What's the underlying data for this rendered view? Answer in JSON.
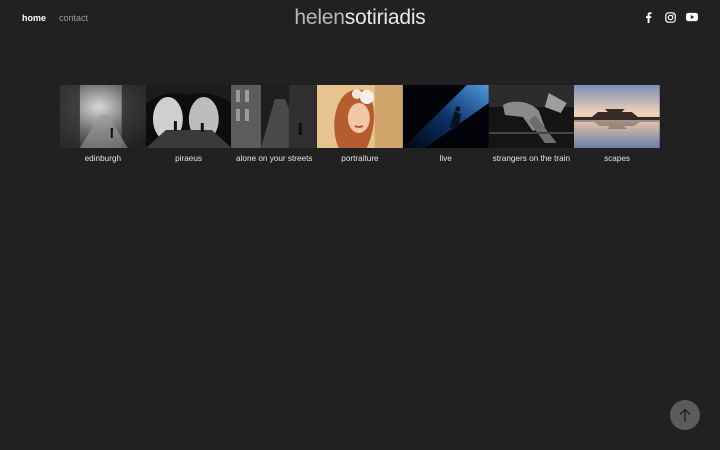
{
  "nav": {
    "home_label": "home",
    "contact_label": "contact"
  },
  "logo": {
    "part1": "helen",
    "part2": "sotiriadis"
  },
  "social": {
    "icons": [
      "facebook-icon",
      "instagram-icon",
      "youtube-icon"
    ]
  },
  "gallery": {
    "items": [
      {
        "label": "edinburgh"
      },
      {
        "label": "piraeus"
      },
      {
        "label": "alone on your streets"
      },
      {
        "label": "portraiture"
      },
      {
        "label": "live"
      },
      {
        "label": "strangers on the train"
      },
      {
        "label": "scapes"
      }
    ]
  },
  "colors": {
    "background": "#212121",
    "nav_active": "#ffffff",
    "nav_inactive": "#9a9a9a",
    "back_to_top": "#5b5b5b"
  },
  "back_to_top": {
    "icon": "arrow-up-icon"
  }
}
